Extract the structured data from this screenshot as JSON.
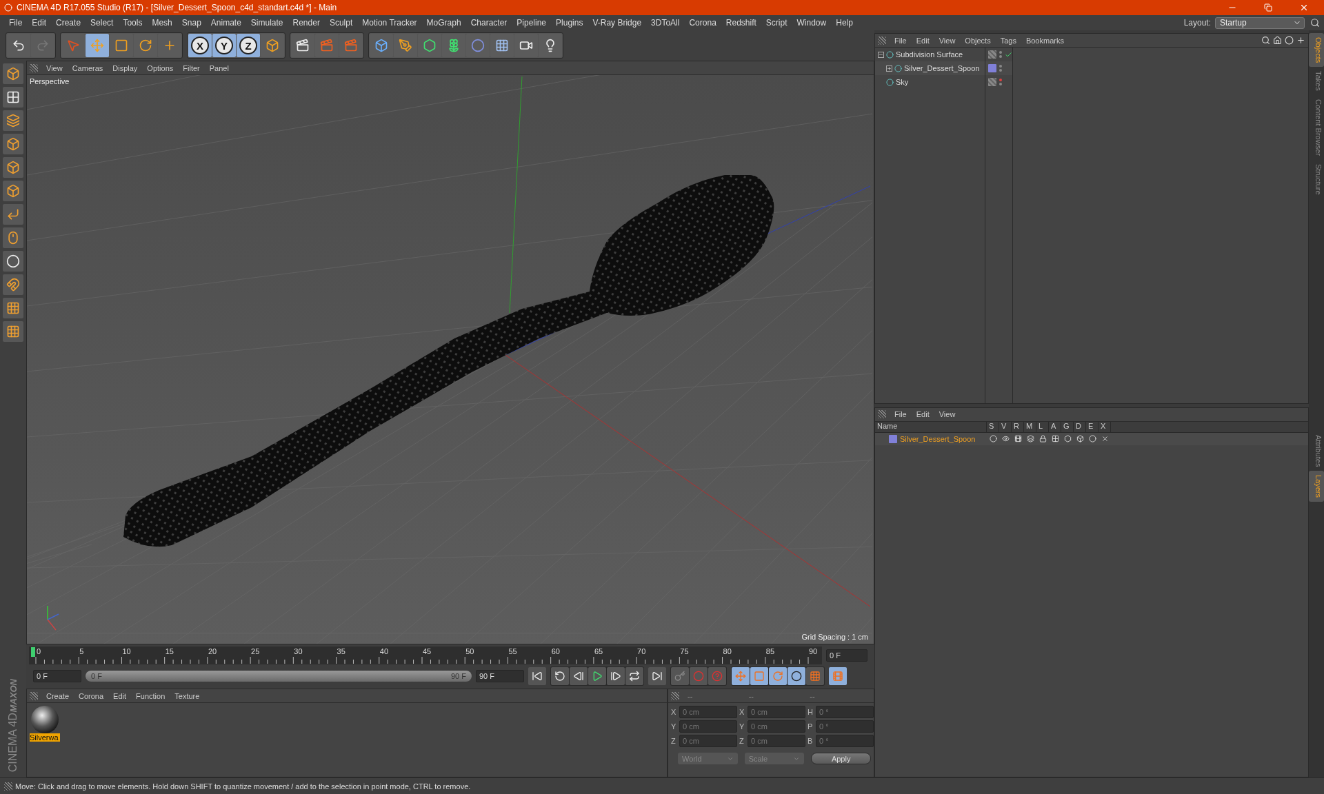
{
  "window": {
    "title": "CINEMA 4D R17.055 Studio (R17) - [Silver_Dessert_Spoon_c4d_standart.c4d *] - Main"
  },
  "menu_bar": [
    "File",
    "Edit",
    "Create",
    "Select",
    "Tools",
    "Mesh",
    "Snap",
    "Animate",
    "Simulate",
    "Render",
    "Sculpt",
    "Motion Tracker",
    "MoGraph",
    "Character",
    "Pipeline",
    "Plugins",
    "V-Ray Bridge",
    "3DToAll",
    "Corona",
    "Redshift",
    "Script",
    "Window",
    "Help"
  ],
  "layout": {
    "label": "Layout:",
    "value": "Startup"
  },
  "toolbar": {
    "tools": [
      {
        "selected": false
      },
      {
        "selected": true
      },
      {
        "selected": false
      },
      {
        "selected": false
      },
      {
        "selected": false
      }
    ],
    "axes": [
      {
        "label": "X",
        "selected": true
      },
      {
        "label": "Y",
        "selected": true
      },
      {
        "label": "Z",
        "selected": true
      }
    ]
  },
  "viewport": {
    "menu": [
      "View",
      "Cameras",
      "Display",
      "Options",
      "Filter",
      "Panel"
    ],
    "camera": "Perspective",
    "grid_spacing": "Grid Spacing : 1 cm"
  },
  "timeline": {
    "ticks": [
      "0",
      "5",
      "10",
      "15",
      "20",
      "25",
      "30",
      "35",
      "40",
      "45",
      "50",
      "55",
      "60",
      "65",
      "70",
      "75",
      "80",
      "85",
      "90"
    ],
    "level": 0,
    "current_frame": "0 F",
    "start_field": "0 F",
    "range": {
      "start": "0 F",
      "end": "90 F",
      "level": 1
    },
    "end_field": "90 F"
  },
  "objects_panel": {
    "menu": [
      "File",
      "Edit",
      "View",
      "Objects",
      "Tags",
      "Bookmarks"
    ],
    "objects": [
      {
        "name": "Subdivision Surface",
        "expanded": true,
        "check": true,
        "hidden": false,
        "children": [
          {
            "name": "Silver_Dessert_Spoon",
            "expanded": false,
            "check": false,
            "hidden": false,
            "color": "#8080d8"
          }
        ]
      },
      {
        "name": "Sky",
        "check": false,
        "hidden": true
      }
    ]
  },
  "layers_panel": {
    "menu": [
      "File",
      "Edit",
      "View"
    ],
    "columns": [
      "Name",
      "S",
      "V",
      "R",
      "M",
      "L",
      "A",
      "G",
      "D",
      "E",
      "X"
    ],
    "layers": [
      {
        "name": "Silver_Dessert_Spoon",
        "color": "#8080d8"
      }
    ]
  },
  "materials": {
    "menu": [
      "Create",
      "Corona",
      "Edit",
      "Function",
      "Texture"
    ],
    "items": [
      {
        "name": "Silverwa",
        "selected": true
      }
    ]
  },
  "coordinates": {
    "headers": [
      "--",
      "--",
      "--"
    ],
    "columns": [
      {
        "fields": [
          {
            "label": "X",
            "value": "0 cm"
          },
          {
            "label": "Y",
            "value": "0 cm"
          },
          {
            "label": "Z",
            "value": "0 cm"
          }
        ]
      },
      {
        "fields": [
          {
            "label": "X",
            "value": "0 cm"
          },
          {
            "label": "Y",
            "value": "0 cm"
          },
          {
            "label": "Z",
            "value": "0 cm"
          }
        ]
      },
      {
        "fields": [
          {
            "label": "H",
            "value": "0 °"
          },
          {
            "label": "P",
            "value": "0 °"
          },
          {
            "label": "B",
            "value": "0 °"
          }
        ]
      }
    ],
    "selects": [
      "World",
      "Scale"
    ],
    "apply": "Apply"
  },
  "brand": {
    "company": "MAXON",
    "product": "CINEMA 4D"
  },
  "side_tabs": {
    "top": [
      {
        "label": "Objects",
        "selected": true
      },
      {
        "label": "Takes",
        "selected": false
      },
      {
        "label": "Content Browser",
        "selected": false
      },
      {
        "label": "Structure",
        "selected": false
      }
    ],
    "bottom": [
      {
        "label": "Attributes",
        "selected": false
      },
      {
        "label": "Layers",
        "selected": true
      }
    ]
  },
  "status_bar": {
    "text": "Move: Click and drag to move elements. Hold down SHIFT to quantize movement / add to the selection in point mode, CTRL to remove."
  }
}
